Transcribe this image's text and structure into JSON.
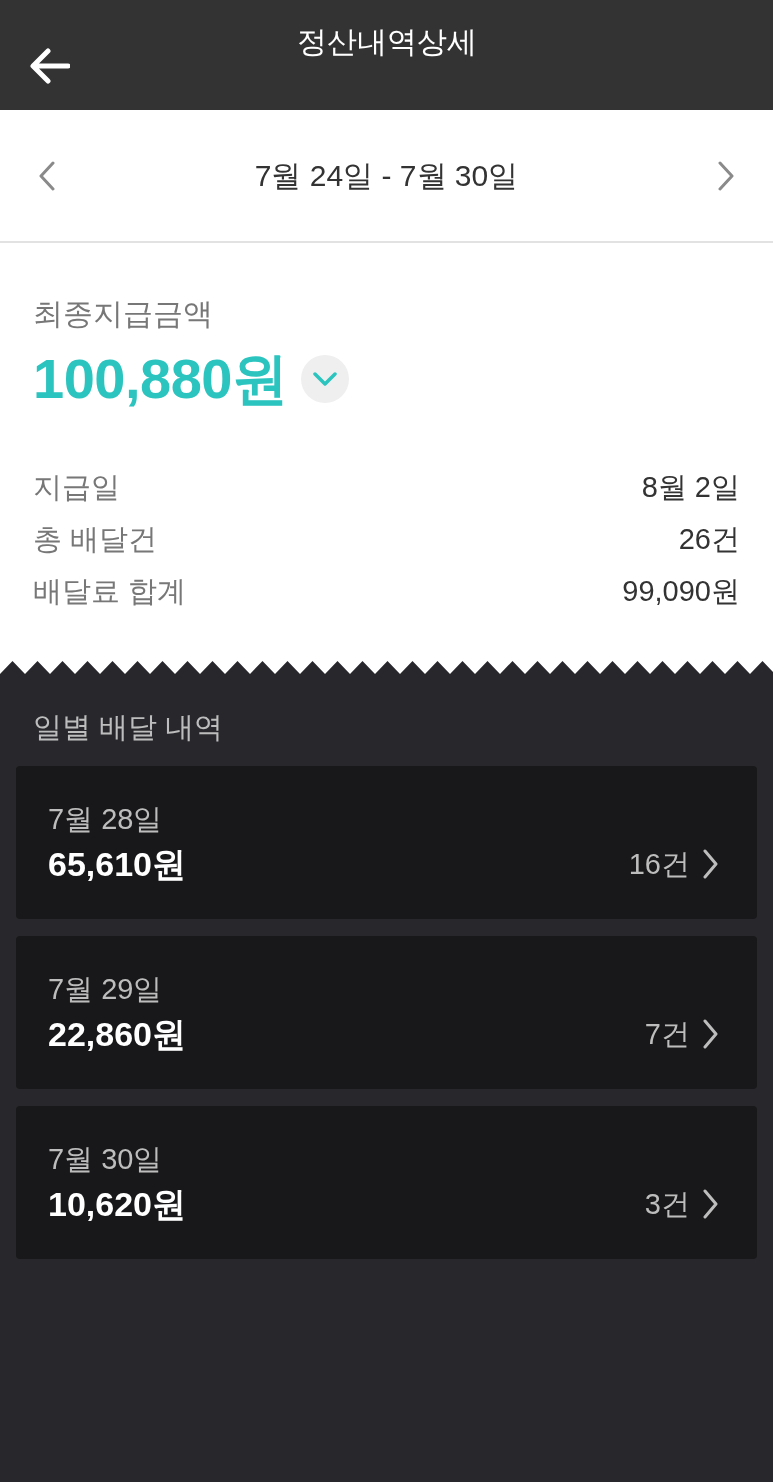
{
  "header": {
    "title": "정산내역상세"
  },
  "period": {
    "label": "7월 24일 - 7월 30일"
  },
  "summary": {
    "label": "최종지급금액",
    "amount": "100,880원",
    "expanded": false,
    "details": [
      {
        "label": "지급일",
        "value": "8월 2일"
      },
      {
        "label": "총 배달건",
        "value": "26건"
      },
      {
        "label": "배달료 합계",
        "value": "99,090원"
      }
    ]
  },
  "daily": {
    "title": "일별 배달 내역",
    "items": [
      {
        "date": "7월 28일",
        "amount": "65,610원",
        "count": "16건"
      },
      {
        "date": "7월 29일",
        "amount": "22,860원",
        "count": "7건"
      },
      {
        "date": "7월 30일",
        "amount": "10,620원",
        "count": "3건"
      }
    ]
  }
}
